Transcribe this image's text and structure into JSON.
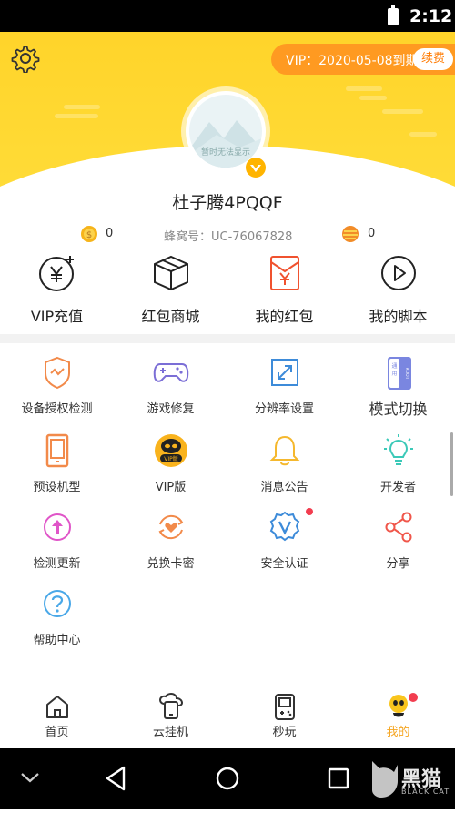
{
  "status_bar": {
    "time": "2:12"
  },
  "header": {
    "vip_text": "VIP：2020-05-08到期",
    "renew_label": "续费",
    "avatar_placeholder": "暂时无法显示"
  },
  "profile": {
    "username": "杜子腾4PQQF",
    "coin1_value": "0",
    "uid": "蜂窝号：UC-76067828",
    "coin2_value": "0"
  },
  "quick_actions": [
    {
      "label": "VIP充值",
      "icon": "yen-plus-icon"
    },
    {
      "label": "红包商城",
      "icon": "box-icon"
    },
    {
      "label": "我的红包",
      "icon": "red-envelope-icon",
      "badge": true
    },
    {
      "label": "我的脚本",
      "icon": "play-circle-icon"
    }
  ],
  "grid": [
    {
      "label": "设备授权检测",
      "icon": "shield-icon"
    },
    {
      "label": "游戏修复",
      "icon": "gamepad-icon"
    },
    {
      "label": "分辨率设置",
      "icon": "resize-icon"
    },
    {
      "label": "模式切换",
      "icon": "mode-switch-icon"
    },
    {
      "label": "预设机型",
      "icon": "phone-icon"
    },
    {
      "label": "VIP版",
      "icon": "vip-bee-icon"
    },
    {
      "label": "消息公告",
      "icon": "bell-icon",
      "badge": true
    },
    {
      "label": "开发者",
      "icon": "bulb-icon"
    },
    {
      "label": "检测更新",
      "icon": "update-icon"
    },
    {
      "label": "兑换卡密",
      "icon": "exchange-heart-icon"
    },
    {
      "label": "安全认证",
      "icon": "verified-icon"
    },
    {
      "label": "分享",
      "icon": "share-icon"
    },
    {
      "label": "帮助中心",
      "icon": "help-icon"
    }
  ],
  "mode_switch_text": [
    "通",
    "用",
    "ROOT"
  ],
  "vip_badge_text": "VIP版",
  "tabs": [
    {
      "label": "首页",
      "icon": "home-icon"
    },
    {
      "label": "云挂机",
      "icon": "cloud-phone-icon"
    },
    {
      "label": "秒玩",
      "icon": "gameboy-icon"
    },
    {
      "label": "我的",
      "icon": "bee-face-icon",
      "active": true
    }
  ],
  "watermark": {
    "text": "黑猫",
    "sub": "BLACK CAT"
  },
  "colors": {
    "primary_yellow": "#ffd42a",
    "vip_orange": "#ff9a21",
    "active_tab": "#f5a623",
    "badge_red": "#f23d4f"
  }
}
